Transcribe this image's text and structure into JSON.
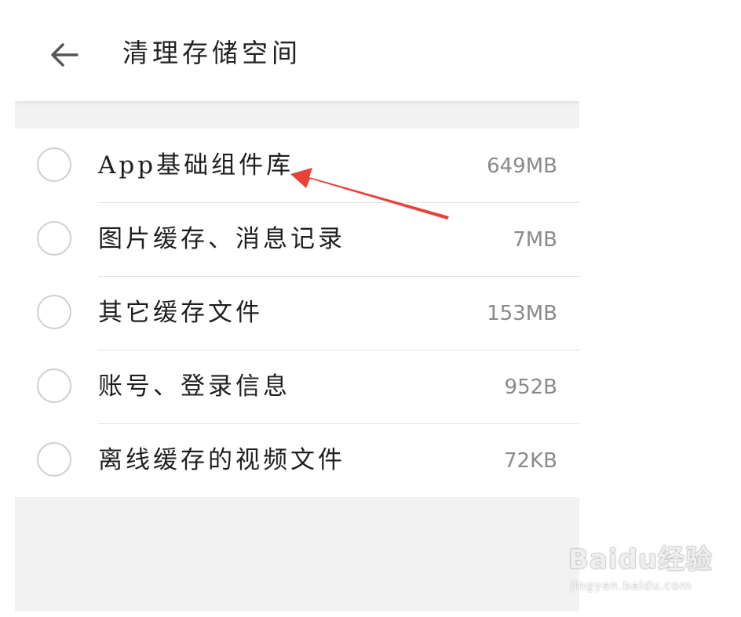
{
  "header": {
    "title": "清理存储空间",
    "back_icon": "arrow-left-icon"
  },
  "items": [
    {
      "label": "App基础组件库",
      "size": "649MB",
      "checked": false
    },
    {
      "label": "图片缓存、消息记录",
      "size": "7MB",
      "checked": false
    },
    {
      "label": "其它缓存文件",
      "size": "153MB",
      "checked": false
    },
    {
      "label": "账号、登录信息",
      "size": "952B",
      "checked": false
    },
    {
      "label": "离线缓存的视频文件",
      "size": "72KB",
      "checked": false
    }
  ],
  "annotation": {
    "arrow_color": "#e8413a"
  },
  "watermark": {
    "main": "Baidu经验",
    "sub": "jingyan.baidu.com"
  },
  "colors": {
    "background": "#f2f2f3",
    "header_bg": "#ffffff",
    "text": "#1f1f1f",
    "size_text": "#8a8a8a",
    "radio_border": "#cfcfcf"
  }
}
